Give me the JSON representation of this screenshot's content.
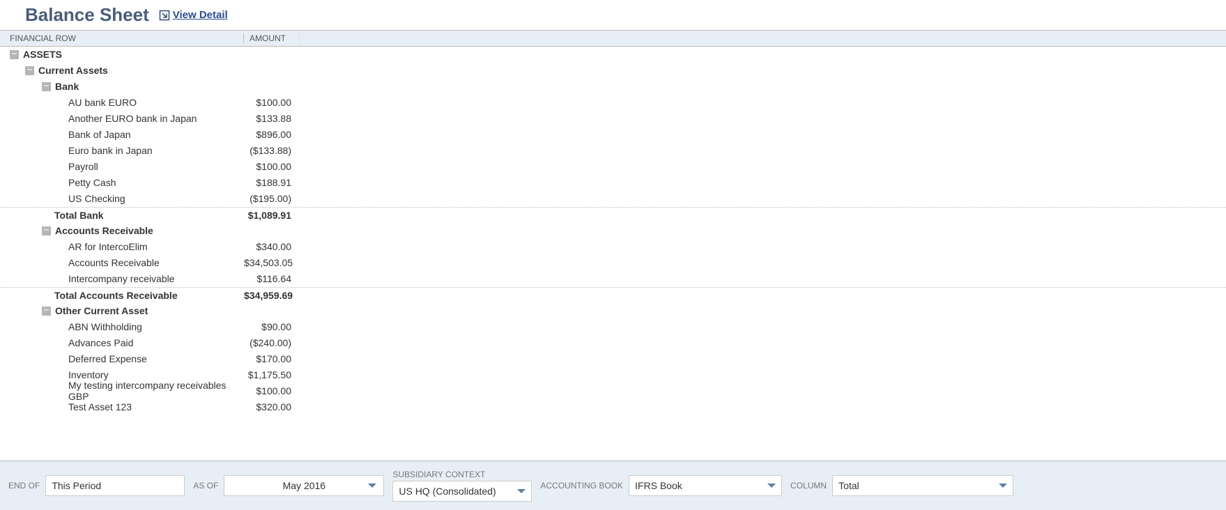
{
  "header": {
    "title": "Balance Sheet",
    "view_detail_label": "View Detail"
  },
  "columns": {
    "name": "FINANCIAL ROW",
    "amount": "AMOUNT"
  },
  "tree": {
    "assets_label": "ASSETS",
    "current_assets_label": "Current Assets",
    "bank": {
      "label": "Bank",
      "rows": [
        {
          "label": "AU bank EURO",
          "amount": "$100.00"
        },
        {
          "label": "Another EURO bank in Japan",
          "amount": "$133.88"
        },
        {
          "label": "Bank of Japan",
          "amount": "$896.00"
        },
        {
          "label": "Euro bank in Japan",
          "amount": "($133.88)"
        },
        {
          "label": "Payroll",
          "amount": "$100.00"
        },
        {
          "label": "Petty Cash",
          "amount": "$188.91"
        },
        {
          "label": "US Checking",
          "amount": "($195.00)"
        }
      ],
      "total_label": "Total Bank",
      "total_amount": "$1,089.91"
    },
    "ar": {
      "label": "Accounts Receivable",
      "rows": [
        {
          "label": "AR for IntercoElim",
          "amount": "$340.00"
        },
        {
          "label": "Accounts Receivable",
          "amount": "$34,503.05"
        },
        {
          "label": "Intercompany receivable",
          "amount": "$116.64"
        }
      ],
      "total_label": "Total Accounts Receivable",
      "total_amount": "$34,959.69"
    },
    "other": {
      "label": "Other Current Asset",
      "rows": [
        {
          "label": "ABN Withholding",
          "amount": "$90.00"
        },
        {
          "label": "Advances Paid",
          "amount": "($240.00)"
        },
        {
          "label": "Deferred Expense",
          "amount": "$170.00"
        },
        {
          "label": "Inventory",
          "amount": "$1,175.50"
        },
        {
          "label": "My testing intercompany receivables GBP",
          "amount": "$100.00"
        },
        {
          "label": "Test Asset 123",
          "amount": "$320.00"
        }
      ]
    }
  },
  "footer": {
    "end_of_label": "END OF",
    "end_of_value": "This Period",
    "as_of_label": "AS OF",
    "as_of_value": "May 2016",
    "subsidiary_label": "SUBSIDIARY CONTEXT",
    "subsidiary_value": "US HQ (Consolidated)",
    "book_label": "ACCOUNTING BOOK",
    "book_value": "IFRS Book",
    "column_label": "COLUMN",
    "column_value": "Total"
  }
}
